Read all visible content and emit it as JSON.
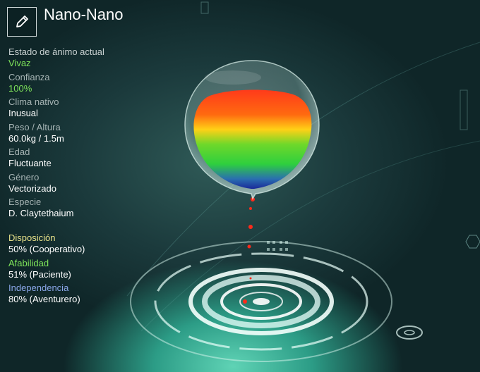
{
  "header": {
    "name": "Nano-Nano",
    "edit_icon": "pencil-icon"
  },
  "stats": [
    {
      "label": "Estado de ánimo actual",
      "value": "Vivaz",
      "value_color": "#7ee35a"
    },
    {
      "label": "Confianza",
      "value": "100%",
      "value_color": "#7ee35a"
    },
    {
      "label": "Clima nativo",
      "value": "Inusual"
    },
    {
      "label": "Peso / Altura",
      "value": "60.0kg / 1.5m"
    },
    {
      "label": "Edad",
      "value": "Fluctuante"
    },
    {
      "label": "Género",
      "value": "Vectorizado"
    },
    {
      "label": "Especie",
      "value": "D. Claytethaium"
    }
  ],
  "traits": [
    {
      "label": "Disposición",
      "value": "50% (Cooperativo)",
      "label_color": "#e8e28a"
    },
    {
      "label": "Afabilidad",
      "value": "51% (Paciente)",
      "label_color": "#7ee35a"
    },
    {
      "label": "Independencia",
      "value": "80% (Aventurero)",
      "label_color": "#8aa6e8"
    }
  ]
}
